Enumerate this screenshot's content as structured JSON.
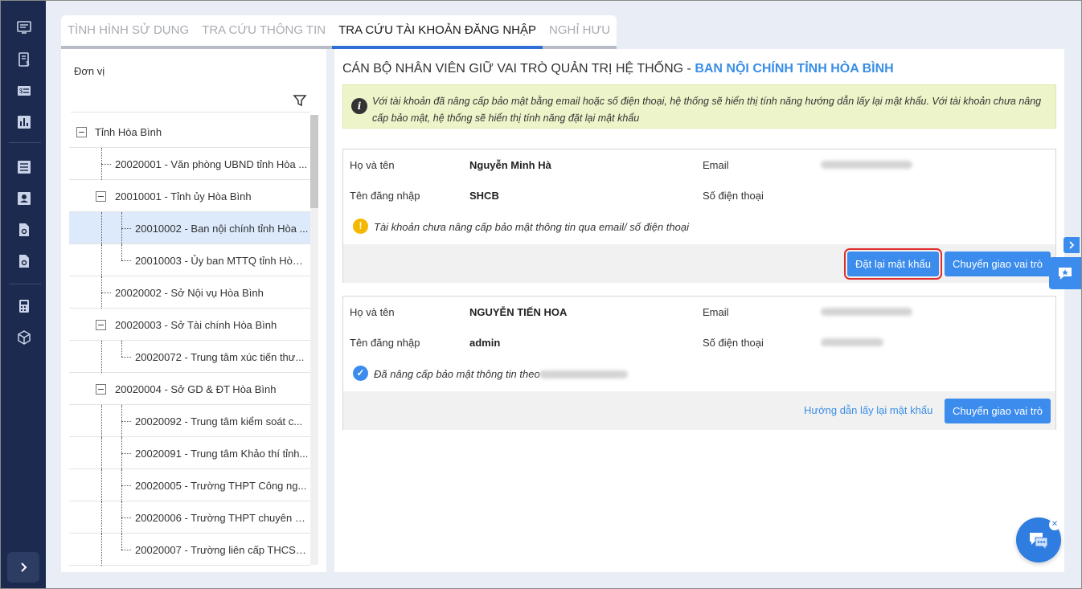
{
  "colors": {
    "accent": "#3b8ced",
    "nav_bg": "#1b2a4e",
    "title_highlight": "#3a8ee6",
    "note_bg": "#eef4c9",
    "warning": "#f5b800",
    "success": "#3b8ced"
  },
  "nav": {
    "icons": [
      "dashboard-icon",
      "invoice-icon",
      "payment-card-icon",
      "bar-chart-icon",
      "list-icon",
      "user-card-icon",
      "file-settings-icon",
      "file-gear-icon",
      "calculator-icon",
      "box-icon",
      "chevron-right-icon"
    ]
  },
  "tabs": [
    {
      "label": "TÌNH HÌNH SỬ DỤNG",
      "active": false
    },
    {
      "label": "TRA CỨU THÔNG TIN",
      "active": false
    },
    {
      "label": "TRA CỨU TÀI KHOẢN ĐĂNG NHẬP",
      "active": true
    },
    {
      "label": "NGHỈ HƯU",
      "active": false
    }
  ],
  "tree": {
    "header": "Đơn vị",
    "rows": [
      {
        "label": "Tỉnh Hòa Bình",
        "level": 0,
        "expandable": true
      },
      {
        "label": "20020001 - Văn phòng UBND tỉnh Hòa ...",
        "level": 1,
        "expandable": false
      },
      {
        "label": "20010001 - Tỉnh ủy Hòa Bình",
        "level": 1,
        "expandable": true
      },
      {
        "label": "20010002 - Ban nội chính tỉnh Hòa ...",
        "level": 2,
        "expandable": false,
        "selected": true
      },
      {
        "label": "20010003 - Ủy ban MTTQ tỉnh Hòa ...",
        "level": 2,
        "expandable": false
      },
      {
        "label": "20020002 - Sở Nội vụ Hòa Bình",
        "level": 1,
        "expandable": false
      },
      {
        "label": "20020003 - Sở Tài chính Hòa Bình",
        "level": 1,
        "expandable": true
      },
      {
        "label": "20020072 - Trung tâm xúc tiến thư...",
        "level": 2,
        "expandable": false
      },
      {
        "label": "20020004 - Sở GD & ĐT Hòa Bình",
        "level": 1,
        "expandable": true
      },
      {
        "label": "20020092 - Trung tâm kiểm soát c...",
        "level": 2,
        "expandable": false
      },
      {
        "label": "20020091 - Trung tâm Khảo thí tỉnh...",
        "level": 2,
        "expandable": false
      },
      {
        "label": "20020005 - Trường THPT Công ng...",
        "level": 2,
        "expandable": false
      },
      {
        "label": "20020006 - Trường THPT chuyên H...",
        "level": 2,
        "expandable": false
      },
      {
        "label": "20020007 - Trường liên cấp THCS&...",
        "level": 2,
        "expandable": false
      }
    ]
  },
  "main": {
    "title_prefix": "CÁN BỘ NHÂN VIÊN GIỮ VAI TRÒ QUẢN TRỊ HỆ THỐNG - ",
    "title_unit": "BAN NỘI CHÍNH TỈNH HÒA BÌNH",
    "note": "Với tài khoản đã nâng cấp bảo mật bằng email hoặc số điện thoại, hệ thống sẽ hiển thị tính năng hướng dẫn lấy lại mật khẩu. Với tài khoản chưa nâng cấp bảo mật, hệ thống sẽ hiển thị tính năng đặt lại mật khẩu",
    "labels": {
      "name": "Họ và tên",
      "username": "Tên đăng nhập",
      "email": "Email",
      "phone": "Số điện thoại"
    },
    "accounts": [
      {
        "name": "Nguyễn Minh Hà",
        "username": "SHCB",
        "status": "Tài khoản chưa nâng cấp bảo mật thông tin qua email/ số điện thoại",
        "primary_action": "Đặt lại mật khẩu",
        "secondary_action": "Chuyển giao vai trò"
      },
      {
        "name": "NGUYỄN TIẾN HOA",
        "username": "admin",
        "status": "Đã nâng cấp bảo mật thông tin theo",
        "link_action": "Hướng dẫn lấy lại mật khẩu",
        "secondary_action": "Chuyển giao vai trò"
      }
    ]
  }
}
